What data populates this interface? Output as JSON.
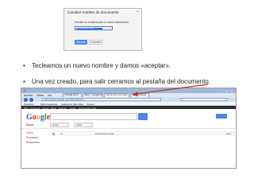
{
  "dialog": {
    "title": "Cambiar nombre de documento",
    "close": "×",
    "prompt": "Escribe un nombre para el nuevo documento:",
    "input_value": "Documento sin título",
    "ok_label": "Aceptar",
    "cancel_label": "Cancelar"
  },
  "bullets": [
    {
      "marker": "•",
      "text": "Tecleamos un nuevo nombre y damos «aceptar»."
    },
    {
      "marker": "•",
      "text": "Una vez creado, para salir cerramos al pestaña del documento."
    }
  ],
  "browser": {
    "window_controls": "– □ ×",
    "menu": [
      "Archivo",
      "Editar",
      "Ver"
    ],
    "tabs": [
      {
        "label": "Google Docs"
      },
      {
        "label": "Docs · Google Docs"
      },
      {
        "label": "Documento sin título"
      },
      {
        "label": "Google Docs"
      }
    ],
    "address": "https://docs.google.com/?pli=1#home",
    "favorites": [
      "Favoritos",
      "Sitios sugeridos",
      "Galería de Web Slice",
      "Posters"
    ],
    "page_links": [
      "Web",
      "Imágenes",
      "Vídeos",
      "Maps",
      "Noticias",
      "Gmail",
      "Documentos",
      "Más"
    ],
    "google_logo": [
      "G",
      "o",
      "o",
      "g",
      "l",
      "e"
    ],
    "section_label": "Docs",
    "toolbar": [
      "Crear",
      "Subir"
    ],
    "sidebar": [
      {
        "label": "Todos",
        "style": "red"
      },
      {
        "label": "Propiedad",
        "style": "gray"
      },
      {
        "label": "Destacados",
        "style": "gray"
      }
    ],
    "file_row": {
      "owner": "Yo",
      "title": "Documento sin título",
      "size": "14:27"
    },
    "accent_colors": {
      "blue": "#4a86e8",
      "red": "#d2352c",
      "arrow": "#c0392b"
    }
  }
}
